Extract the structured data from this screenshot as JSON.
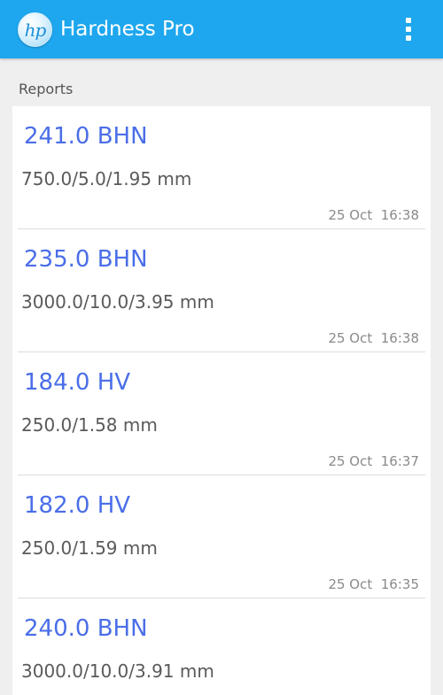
{
  "app": {
    "title": "Hardness Pro",
    "logo_text": "hp",
    "overflow_icon": "more-vertical-icon"
  },
  "section": {
    "title": "Reports"
  },
  "reports": [
    {
      "hardness": "241.0 BHN",
      "params": "750.0/5.0/1.95 mm",
      "date": "25 Oct  16:38"
    },
    {
      "hardness": "235.0 BHN",
      "params": "3000.0/10.0/3.95 mm",
      "date": "25 Oct  16:38"
    },
    {
      "hardness": "184.0 HV",
      "params": "250.0/1.58 mm",
      "date": "25 Oct  16:37"
    },
    {
      "hardness": "182.0 HV",
      "params": "250.0/1.59 mm",
      "date": "25 Oct  16:35"
    },
    {
      "hardness": "240.0 BHN",
      "params": "3000.0/10.0/3.91 mm",
      "date": ""
    }
  ],
  "colors": {
    "action_bar": "#1ea7ee",
    "hardness_text": "#4a6ee8",
    "background": "#efefef"
  }
}
